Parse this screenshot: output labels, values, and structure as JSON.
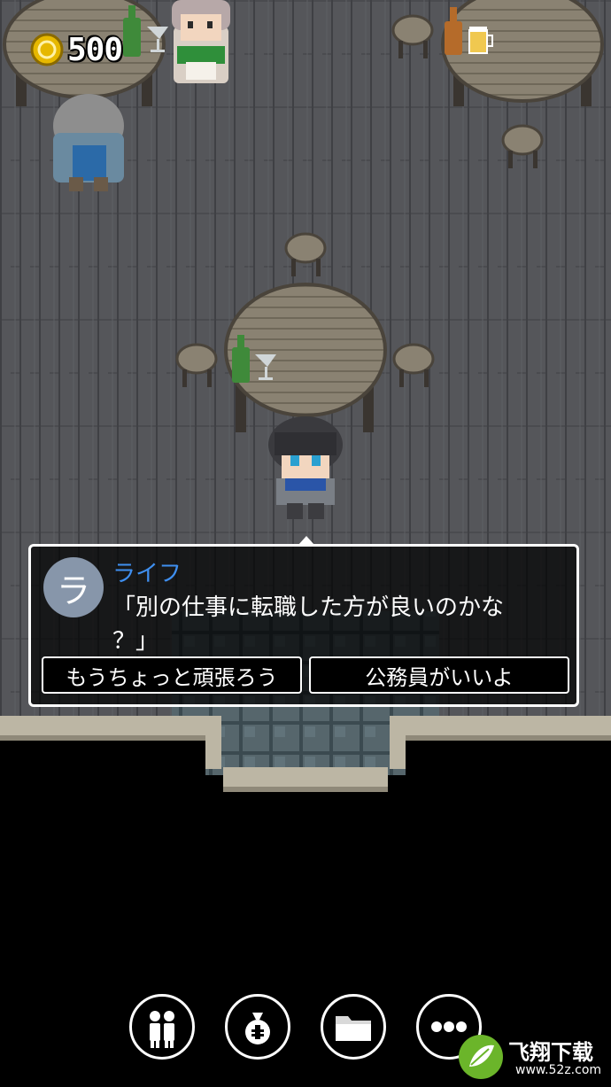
{
  "hud": {
    "coins": "500"
  },
  "dialog": {
    "avatar_initial": "ラ",
    "speaker": "ライフ",
    "line1": "「別の仕事に転職した方が良いのかな",
    "line2": "？」",
    "choices": [
      "もうちょっと頑張ろう",
      "公務員がいいよ"
    ]
  },
  "menu": {
    "icons": [
      "people-icon",
      "money-bag-icon",
      "folder-icon",
      "more-icon"
    ]
  },
  "watermark": {
    "title": "飞翔下载",
    "url": "www.52z.com"
  },
  "colors": {
    "floor": "#55565a",
    "plank_line": "#3f4044",
    "table": "#8a8272",
    "speaker_name": "#3f8ff0",
    "avatar_bg": "#8796aa",
    "wall_trim": "#bcb6a4"
  }
}
